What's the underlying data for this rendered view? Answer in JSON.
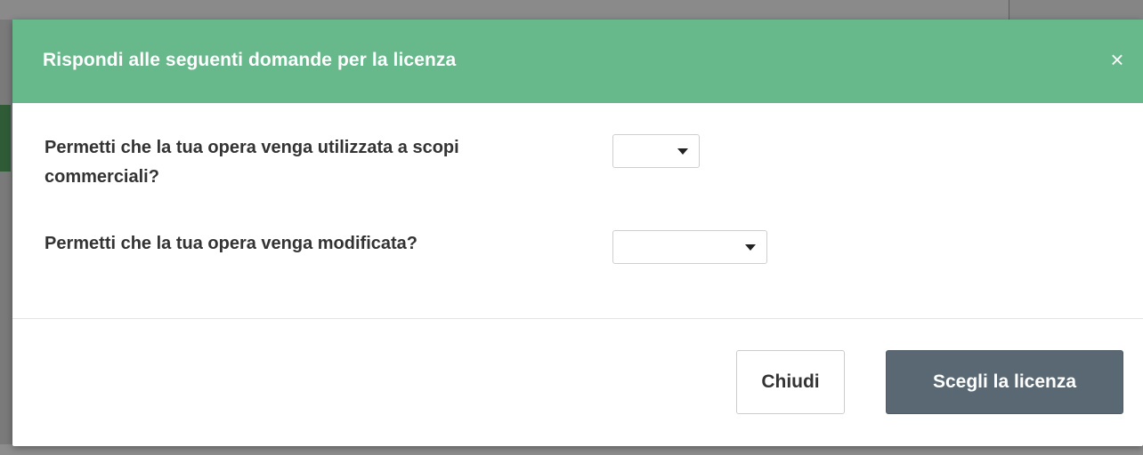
{
  "modal": {
    "title": "Rispondi alle seguenti domande per la licenza",
    "close_symbol": "×",
    "header_color": "#67b88b"
  },
  "questions": [
    {
      "label": "Permetti che la tua opera venga utilizzata a scopi commerciali?",
      "selected_value": ""
    },
    {
      "label": "Permetti che la tua opera venga modificata?",
      "selected_value": ""
    }
  ],
  "footer": {
    "close_label": "Chiudi",
    "choose_label": "Scegli la licenza",
    "primary_color": "#596872"
  },
  "icons": {
    "close": "close-icon",
    "dropdown": "chevron-down-icon"
  }
}
